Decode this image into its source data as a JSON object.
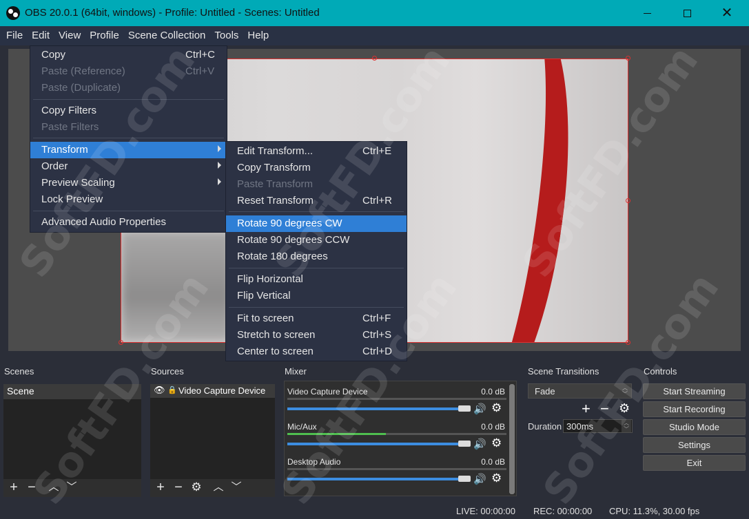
{
  "window": {
    "title": "OBS 20.0.1 (64bit, windows) - Profile: Untitled - Scenes: Untitled",
    "accent": "#00aab7"
  },
  "menubar": [
    "File",
    "Edit",
    "View",
    "Profile",
    "Scene Collection",
    "Tools",
    "Help"
  ],
  "edit_menu": {
    "items": [
      {
        "label": "Copy",
        "shortcut": "Ctrl+C",
        "disabled": false
      },
      {
        "label": "Paste (Reference)",
        "shortcut": "Ctrl+V",
        "disabled": true
      },
      {
        "label": "Paste (Duplicate)",
        "shortcut": "",
        "disabled": true
      },
      {
        "label": "Copy Filters",
        "shortcut": "",
        "disabled": false
      },
      {
        "label": "Paste Filters",
        "shortcut": "",
        "disabled": true
      },
      {
        "label": "Transform",
        "shortcut": "",
        "disabled": false,
        "selected": true,
        "submenu": true
      },
      {
        "label": "Order",
        "shortcut": "",
        "disabled": false,
        "submenu": true
      },
      {
        "label": "Preview Scaling",
        "shortcut": "",
        "disabled": false,
        "submenu": true
      },
      {
        "label": "Lock Preview",
        "shortcut": "",
        "disabled": false
      },
      {
        "label": "Advanced Audio Properties",
        "shortcut": "",
        "disabled": false
      }
    ]
  },
  "transform_menu": {
    "items": [
      {
        "label": "Edit Transform...",
        "shortcut": "Ctrl+E",
        "disabled": false
      },
      {
        "label": "Copy Transform",
        "shortcut": "",
        "disabled": false
      },
      {
        "label": "Paste Transform",
        "shortcut": "",
        "disabled": true
      },
      {
        "label": "Reset Transform",
        "shortcut": "Ctrl+R",
        "disabled": false
      },
      {
        "label": "Rotate 90 degrees CW",
        "shortcut": "",
        "disabled": false,
        "selected": true
      },
      {
        "label": "Rotate 90 degrees CCW",
        "shortcut": "",
        "disabled": false
      },
      {
        "label": "Rotate 180 degrees",
        "shortcut": "",
        "disabled": false
      },
      {
        "label": "Flip Horizontal",
        "shortcut": "",
        "disabled": false
      },
      {
        "label": "Flip Vertical",
        "shortcut": "",
        "disabled": false
      },
      {
        "label": "Fit to screen",
        "shortcut": "Ctrl+F",
        "disabled": false
      },
      {
        "label": "Stretch to screen",
        "shortcut": "Ctrl+S",
        "disabled": false
      },
      {
        "label": "Center to screen",
        "shortcut": "Ctrl+D",
        "disabled": false
      }
    ]
  },
  "docks": {
    "scenes": {
      "title": "Scenes",
      "items": [
        "Scene"
      ]
    },
    "sources": {
      "title": "Sources",
      "items": [
        "Video Capture Device"
      ]
    },
    "mixer": {
      "title": "Mixer",
      "tracks": [
        {
          "name": "Video Capture Device",
          "db": "0.0 dB",
          "level": 0.0
        },
        {
          "name": "Mic/Aux",
          "db": "0.0 dB",
          "level": 0.45
        },
        {
          "name": "Desktop Audio",
          "db": "0.0 dB",
          "level": 0.0
        }
      ]
    },
    "transitions": {
      "title": "Scene Transitions",
      "selected": "Fade",
      "duration_label": "Duration",
      "duration_value": "300ms"
    },
    "controls": {
      "title": "Controls",
      "buttons": [
        "Start Streaming",
        "Start Recording",
        "Studio Mode",
        "Settings",
        "Exit"
      ]
    }
  },
  "status": {
    "live": "LIVE: 00:00:00",
    "rec": "REC: 00:00:00",
    "cpu": "CPU: 11.3%, 30.00 fps"
  },
  "watermark": "SoftFD.com"
}
